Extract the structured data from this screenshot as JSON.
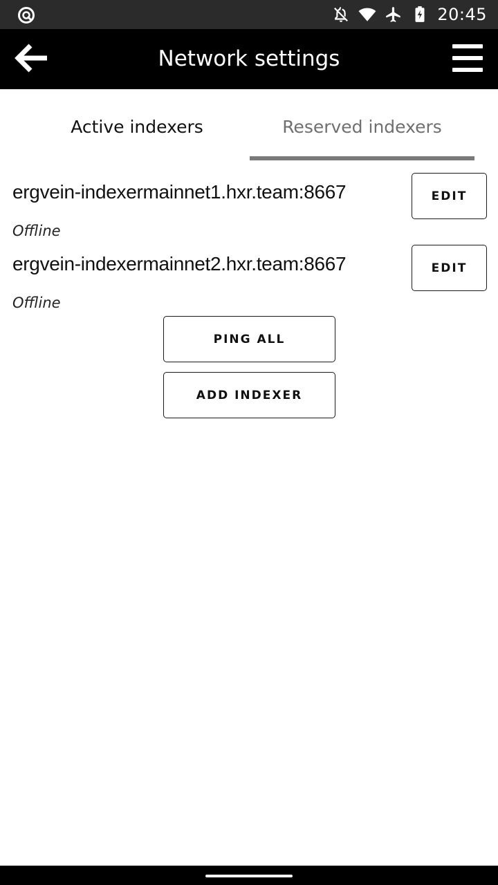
{
  "status_bar": {
    "time": "20:45",
    "icons": [
      "app-notification-icon",
      "notifications-off-icon",
      "wifi-icon",
      "airplane-mode-icon",
      "battery-charging-icon"
    ]
  },
  "app_bar": {
    "title": "Network settings",
    "back_icon": "arrow-left-icon",
    "menu_icon": "hamburger-menu-icon"
  },
  "tabs": [
    {
      "label": "Active indexers",
      "selected": false
    },
    {
      "label": "Reserved indexers",
      "selected": true
    }
  ],
  "indexers": [
    {
      "host": "ergvein-indexermainnet1.hxr.team:8667",
      "status": "Offline",
      "edit_label": "EDIT"
    },
    {
      "host": "ergvein-indexermainnet2.hxr.team:8667",
      "status": "Offline",
      "edit_label": "EDIT"
    }
  ],
  "actions": {
    "ping_all": "PING ALL",
    "add_indexer": "ADD INDEXER"
  },
  "colors": {
    "status_bar_bg": "#2b2b2b",
    "app_bar_bg": "#000000",
    "page_bg": "#ffffff",
    "tab_indicator": "#7a7a7a"
  }
}
